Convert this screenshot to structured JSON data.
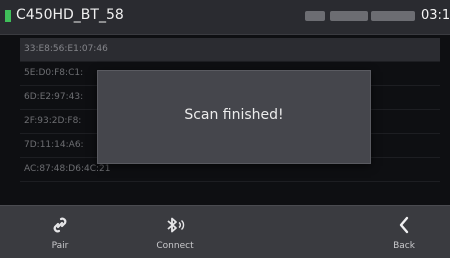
{
  "app": {
    "title": "C450HD_BT_58",
    "clock": "03:1",
    "indicators": [
      "",
      "",
      ""
    ]
  },
  "devices": [
    {
      "address": "33:E8:56:E1:07:46"
    },
    {
      "address": "5E:D0:F8:C1:"
    },
    {
      "address": "6D:E2:97:43:"
    },
    {
      "address": "2F:93:2D:F8:"
    },
    {
      "address": "7D:11:14:A6:"
    },
    {
      "address": "AC:87:48:D6:4C:21"
    }
  ],
  "dialog": {
    "message": "Scan finished!"
  },
  "toolbar": {
    "pair_label": "Pair",
    "connect_label": "Connect",
    "back_label": "Back"
  },
  "colors": {
    "status_dot": "#3fbf5a",
    "background": "#0e0f12",
    "dialog": "#45464c",
    "bars": "#3a3b40"
  },
  "icons": {
    "pair": "link-icon",
    "connect": "bluetooth-icon",
    "back": "chevron-left-icon"
  }
}
